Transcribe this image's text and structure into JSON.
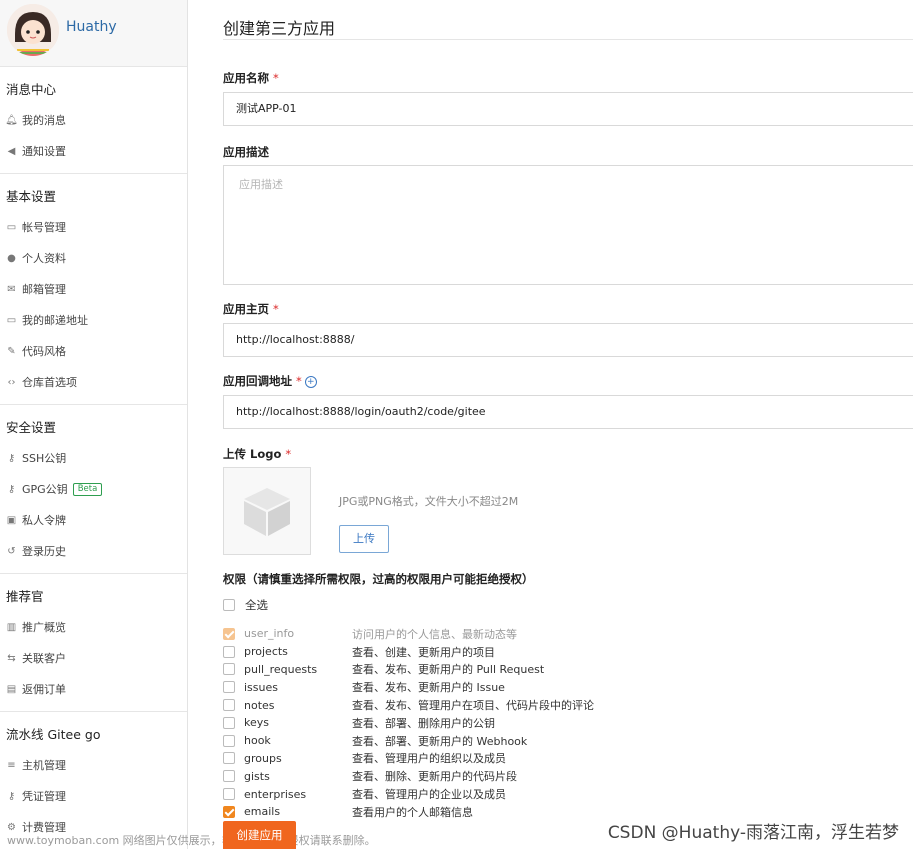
{
  "user": {
    "name": "Huathy"
  },
  "sidebar": {
    "groups": [
      {
        "title": "消息中心",
        "items": [
          {
            "label": "我的消息",
            "icon": "bell-icon"
          },
          {
            "label": "通知设置",
            "icon": "speaker-icon"
          }
        ]
      },
      {
        "title": "基本设置",
        "items": [
          {
            "label": "帐号管理",
            "icon": "id-card-icon"
          },
          {
            "label": "个人资料",
            "icon": "user-icon"
          },
          {
            "label": "邮箱管理",
            "icon": "mail-icon"
          },
          {
            "label": "我的邮递地址",
            "icon": "address-card-icon"
          },
          {
            "label": "代码风格",
            "icon": "brush-icon"
          },
          {
            "label": "仓库首选项",
            "icon": "code-icon"
          }
        ]
      },
      {
        "title": "安全设置",
        "items": [
          {
            "label": "SSH公钥",
            "icon": "key-icon"
          },
          {
            "label": "GPG公钥",
            "icon": "key-icon",
            "badge": "Beta"
          },
          {
            "label": "私人令牌",
            "icon": "lock-icon"
          },
          {
            "label": "登录历史",
            "icon": "history-icon"
          }
        ]
      },
      {
        "title": "推荐官",
        "items": [
          {
            "label": "推广概览",
            "icon": "chart-icon"
          },
          {
            "label": "关联客户",
            "icon": "share-icon"
          },
          {
            "label": "返佣订单",
            "icon": "order-icon"
          }
        ]
      },
      {
        "title": "流水线 Gitee go",
        "items": [
          {
            "label": "主机管理",
            "icon": "server-icon"
          },
          {
            "label": "凭证管理",
            "icon": "key-icon"
          },
          {
            "label": "计费管理",
            "icon": "billing-icon"
          }
        ]
      }
    ]
  },
  "form": {
    "title": "创建第三方应用",
    "name_label": "应用名称",
    "name_value": "测试APP-01",
    "desc_label": "应用描述",
    "desc_placeholder": "应用描述",
    "homepage_label": "应用主页",
    "homepage_value": "http://localhost:8888/",
    "callback_label": "应用回调地址",
    "callback_value": "http://localhost:8888/login/oauth2/code/gitee",
    "logo_label": "上传 Logo",
    "logo_hint": "JPG或PNG格式，文件大小不超过2M",
    "upload_label": "上传",
    "required_mark": "*",
    "perm_title": "权限（请慎重选择所需权限，过高的权限用户可能拒绝授权）",
    "select_all": "全选",
    "permissions": [
      {
        "name": "user_info",
        "desc": "访问用户的个人信息、最新动态等",
        "checked": true,
        "disabled": true
      },
      {
        "name": "projects",
        "desc": "查看、创建、更新用户的项目",
        "checked": false
      },
      {
        "name": "pull_requests",
        "desc": "查看、发布、更新用户的 Pull Request",
        "checked": false
      },
      {
        "name": "issues",
        "desc": "查看、发布、更新用户的 Issue",
        "checked": false
      },
      {
        "name": "notes",
        "desc": "查看、发布、管理用户在项目、代码片段中的评论",
        "checked": false
      },
      {
        "name": "keys",
        "desc": "查看、部署、删除用户的公钥",
        "checked": false
      },
      {
        "name": "hook",
        "desc": "查看、部署、更新用户的 Webhook",
        "checked": false
      },
      {
        "name": "groups",
        "desc": "查看、管理用户的组织以及成员",
        "checked": false
      },
      {
        "name": "gists",
        "desc": "查看、删除、更新用户的代码片段",
        "checked": false
      },
      {
        "name": "enterprises",
        "desc": "查看、管理用户的企业以及成员",
        "checked": false
      },
      {
        "name": "emails",
        "desc": "查看用户的个人邮箱信息",
        "checked": true
      }
    ],
    "create_label": "创建应用"
  },
  "overlay": {
    "watermark": "www.toymoban.com 网络图片仅供展示，非存储，如有侵权请联系删除。",
    "csdn": "CSDN @Huathy-雨落江南，浮生若梦"
  },
  "colors": {
    "accent": "#f0661e",
    "link": "#2d6aa6",
    "checkbox": "#f0861e"
  }
}
